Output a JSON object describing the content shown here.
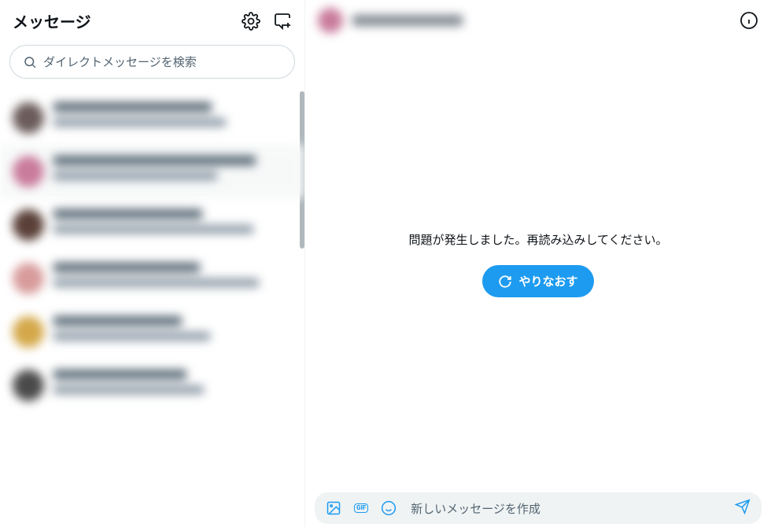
{
  "sidebar": {
    "title": "メッセージ",
    "search_placeholder": "ダイレクトメッセージを検索",
    "conversations": [
      {
        "avatar_color": "#6b5b5b",
        "selected": false
      },
      {
        "avatar_color": "#c97b9b",
        "selected": true
      },
      {
        "avatar_color": "#5a4038",
        "selected": false
      },
      {
        "avatar_color": "#d89b9b",
        "selected": false
      },
      {
        "avatar_color": "#d4a84a",
        "selected": false
      },
      {
        "avatar_color": "#4a4a4a",
        "selected": false
      }
    ]
  },
  "main": {
    "error_message": "問題が発生しました。再読み込みしてください。",
    "retry_label": "やりなおす",
    "composer_placeholder": "新しいメッセージを作成",
    "gif_label": "GIF"
  }
}
